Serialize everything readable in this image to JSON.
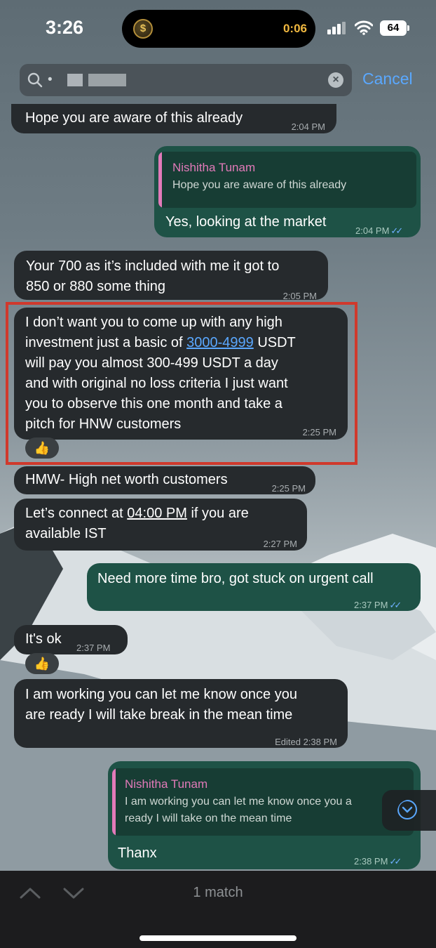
{
  "status_bar": {
    "time": "3:26",
    "timer": "0:06",
    "battery": "64",
    "coin_symbol": "$"
  },
  "search": {
    "value": "• ",
    "clear_symbol": "×",
    "cancel_label": "Cancel"
  },
  "messages": {
    "m1": {
      "text": "Hope you are aware of this already",
      "time": "2:04 PM"
    },
    "m2": {
      "reply_name": "Nishitha Tunam",
      "reply_text": "Hope you are aware of this already",
      "text": "Yes, looking at the market",
      "time": "2:04 PM",
      "check": "✓✓"
    },
    "m3": {
      "line1": "Your 700 as it’s included with me it got to",
      "line2": "850 or 880 some thing",
      "time": "2:05 PM"
    },
    "m4": {
      "line1": "I don’t want you to come up with any high",
      "line2_pre": "investment just a basic of ",
      "line2_link": "3000-4999",
      "line2_post": " USDT",
      "line3": "will pay you almost 300-499 USDT a day",
      "line4": "and with original no loss criteria I just want",
      "line5": "you to observe this one month and take a",
      "line6": "pitch for HNW customers",
      "time": "2:25 PM",
      "reaction": "👍"
    },
    "m5": {
      "text": "HMW- High net worth customers",
      "time": "2:25 PM"
    },
    "m6": {
      "line1_pre": "Let’s connect at ",
      "line1_link": "04:00 PM",
      "line1_post": " if you are",
      "line2": "available IST",
      "time": "2:27 PM"
    },
    "m7": {
      "text": "Need more time bro, got stuck on urgent call",
      "time": "2:37 PM",
      "check": "✓✓"
    },
    "m8": {
      "text": "It's ok",
      "time": "2:37 PM",
      "reaction": "👍"
    },
    "m9": {
      "line1": "I am working you can let me know once you",
      "line2": "are ready I will take break in the mean time",
      "time": "Edited 2:38 PM"
    },
    "m10": {
      "reply_name": "Nishitha Tunam",
      "reply_line1": "I am working you can let me know once you a",
      "reply_line2": "ready I will take on the mean time",
      "text": "Thanx",
      "time": "2:38 PM",
      "check": "✓✓"
    }
  },
  "bottom_bar": {
    "match_count": "1 match"
  },
  "colors": {
    "incoming": "#262a2d",
    "outgoing": "#1e5246",
    "accent": "#5aa8ff",
    "reply_name": "#e27ab9",
    "highlight": "#d0392c"
  }
}
